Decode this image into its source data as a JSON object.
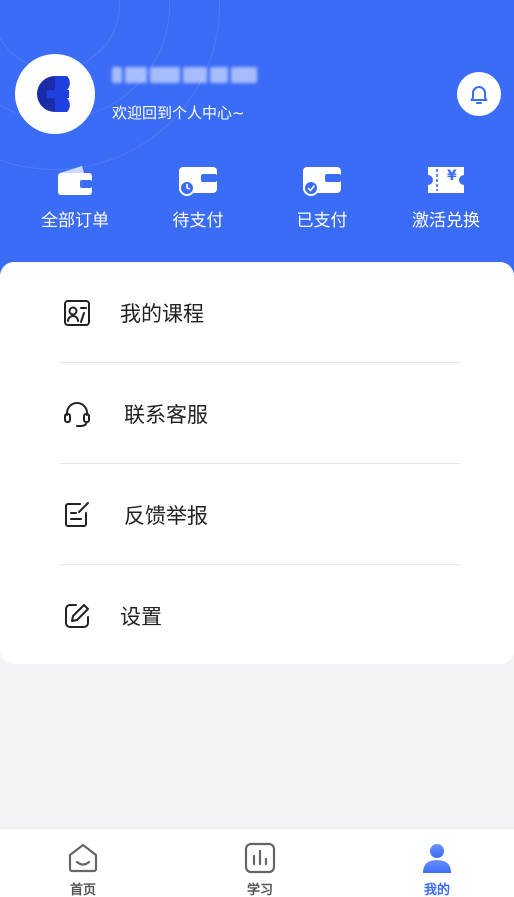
{
  "profile": {
    "welcome": "欢迎回到个人中心~"
  },
  "orders": [
    {
      "label": "全部订单",
      "icon": "wallet-icon"
    },
    {
      "label": "待支付",
      "icon": "wallet-clock-icon"
    },
    {
      "label": "已支付",
      "icon": "wallet-check-icon"
    },
    {
      "label": "激活兑换",
      "icon": "ticket-yen-icon"
    }
  ],
  "ticket_symbol": "¥",
  "menu": [
    {
      "label": "我的课程",
      "icon": "course-card-icon"
    },
    {
      "label": "联系客服",
      "icon": "headset-icon"
    },
    {
      "label": "反馈举报",
      "icon": "feedback-edit-icon"
    },
    {
      "label": "设置",
      "icon": "settings-edit-icon"
    }
  ],
  "tabbar": [
    {
      "label": "首页",
      "icon": "home-icon",
      "active": false
    },
    {
      "label": "学习",
      "icon": "chart-icon",
      "active": false
    },
    {
      "label": "我的",
      "icon": "user-icon",
      "active": true
    }
  ],
  "colors": {
    "brand": "#3b6cf6",
    "text": "#222222",
    "background": "#f4f4f6"
  }
}
